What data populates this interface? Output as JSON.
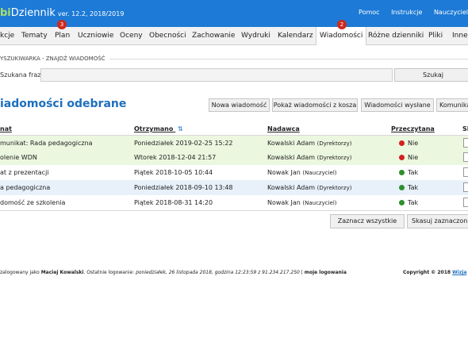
{
  "header": {
    "brand": "bDziennik",
    "brand_first": "bi",
    "brand_second": "Dziennik",
    "version": "ver. 12.2, 2018/2019",
    "links": [
      "Pomoc",
      "Instrukcje",
      "Nauczyciel"
    ]
  },
  "tabs": [
    {
      "label": "kcje"
    },
    {
      "label": "Tematy"
    },
    {
      "label": "Plan",
      "badge": "3"
    },
    {
      "label": "Uczniowie"
    },
    {
      "label": "Oceny"
    },
    {
      "label": "Obecności"
    },
    {
      "label": "Zachowanie"
    },
    {
      "label": "Wydruki"
    },
    {
      "label": "Kalendarz"
    },
    {
      "label": "Wiadomości",
      "badge": "2",
      "active": true
    },
    {
      "label": "Różne dzienniki"
    },
    {
      "label": "Pliki"
    },
    {
      "label": "Inne"
    }
  ],
  "search": {
    "section_title": "YSZUKIWARKA - ZNAJDŹ WIADOMOŚĆ",
    "label": "Szukana fraza",
    "value": "",
    "button": "Szukaj"
  },
  "page_title": "iadomości odebrane",
  "actions": [
    "Nowa wiadomość",
    "Pokaż wiadomości z kosza",
    "Wiadomości wysłane",
    "Komunika"
  ],
  "table": {
    "headers": [
      "nat",
      "Otrzymano",
      "Nadawca",
      "Przeczytana",
      "Sk"
    ],
    "rows": [
      {
        "subject": "munikat: Rada pedagogiczna",
        "date": "Poniedziałek 2019-02-25 15:22",
        "sender": "Kowalski Adam",
        "role": "(Dyrektorzy)",
        "read": "Nie",
        "bg": "#ebf7df"
      },
      {
        "subject": "olenie WDN",
        "date": "Wtorek 2018-12-04 21:57",
        "sender": "Kowalski Adam",
        "role": "(Dyrektorzy)",
        "read": "Nie",
        "bg": "#ebf7df"
      },
      {
        "subject": "at z prezentacji",
        "date": "Piątek 2018-10-05 10:44",
        "sender": "Nowak Jan",
        "role": "(Nauczyciel)",
        "read": "Tak",
        "bg": "#ffffff"
      },
      {
        "subject": "a pedagogiczna",
        "date": "Poniedziałek 2018-09-10 13:48",
        "sender": "Kowalski Adam",
        "role": "(Dyrektorzy)",
        "read": "Tak",
        "bg": "#e8f1fa"
      },
      {
        "subject": "domość ze szkolenia",
        "date": "Piątek 2018-08-31 14:20",
        "sender": "Nowak Jan",
        "role": "(Nauczyciel)",
        "read": "Tak",
        "bg": "#ffffff"
      }
    ]
  },
  "bulk": {
    "select_all": "Zaznacz wszystkie",
    "delete": "Skasuj zaznaczon"
  },
  "footer": {
    "prefix": "zalogowany jako",
    "user": "Maciej Kowalski",
    "last_login_label": ". Ostatnie logowanie:",
    "last_login": "poniedziałek, 26 listopada 2018, godzina 12:23:59 z 91.234.217.250",
    "separator": "|",
    "my_logins": "moje logowania",
    "copyright": "Copyright © 2018",
    "vendor": "Wizja"
  },
  "colors": {
    "accent": "#1d7ad6",
    "unread_dot": "#d42020",
    "read_dot": "#2f8f2f",
    "badge": "#cc2a1e",
    "title": "#1d6fbd"
  }
}
